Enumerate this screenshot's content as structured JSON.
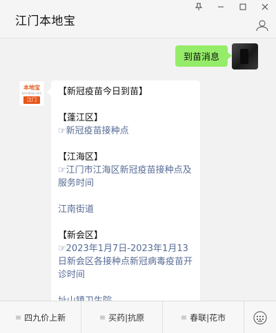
{
  "window": {
    "title": "江门本地宝",
    "controls": {
      "pin": "⌓",
      "minimize": "—",
      "maximize": "□",
      "close": "✕"
    }
  },
  "messages": {
    "outgoing": {
      "text": "到苗消息"
    },
    "incoming": {
      "avatar_logo_top": "本地宝",
      "avatar_logo_sub": "bendibao.com",
      "avatar_logo_bottom": "江门",
      "lines": {
        "title": "【新冠疫苗今日到苗】",
        "s1_header": "【蓬江区】",
        "s1_link": "☞新冠疫苗接种点",
        "s2_header": "【江海区】",
        "s2_link": "☞江门市江海区新冠疫苗接种点及服务时间",
        "s2_plain": "江南街道",
        "s3_header": "【新会区】",
        "s3_link": "☞2023年1月7日-2023年1月13日新会区各接种点新冠病毒疫苗开诊时间",
        "s3_next": "址山镇卫生院"
      }
    }
  },
  "menu": {
    "items": [
      {
        "label": "四九价上新",
        "icon": "≡"
      },
      {
        "label": "买药|抗原",
        "icon": "≡"
      },
      {
        "label": "春联|花市",
        "icon": "≡"
      }
    ]
  },
  "colors": {
    "bubble_me": "#95ec69",
    "link": "#576b95",
    "logo": "#e8561a"
  }
}
